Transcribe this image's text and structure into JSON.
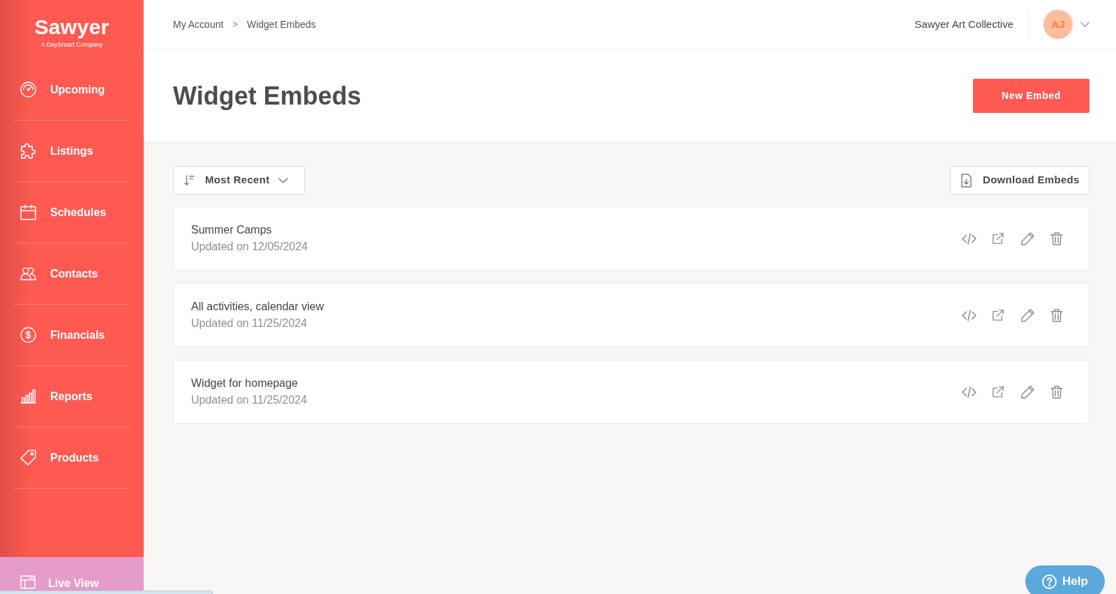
{
  "sidebar": {
    "logo": "Sawyer",
    "tagline": "A DaySmart Company",
    "items": [
      {
        "label": "Upcoming",
        "selected": false
      },
      {
        "label": "Listings",
        "selected": false
      },
      {
        "label": "Schedules",
        "selected": false
      },
      {
        "label": "Contacts",
        "selected": false
      },
      {
        "label": "Financials",
        "selected": false
      },
      {
        "label": "Reports",
        "selected": false
      },
      {
        "label": "Products",
        "selected": false
      }
    ],
    "live_view": {
      "label": "Live View"
    }
  },
  "header": {
    "breadcrumb": [
      {
        "label": "My Account"
      },
      {
        "label": "Widget Embeds"
      }
    ],
    "breadcrumb_separator": ">",
    "organization": "Sawyer Art Collective",
    "avatar_initials": "AJ"
  },
  "page": {
    "title": "Widget Embeds",
    "new_button": "New Embed"
  },
  "toolbar": {
    "sort_label": "Most Recent",
    "download_button": "Download Embeds"
  },
  "embeds": [
    {
      "name": "Summer Camps",
      "updated": "Updated on 12/05/2024"
    },
    {
      "name": "All activities, calendar view",
      "updated": "Updated on 11/25/2024"
    },
    {
      "name": "Widget for homepage",
      "updated": "Updated on 11/25/2024"
    }
  ],
  "help_button": {
    "label": "Help"
  }
}
